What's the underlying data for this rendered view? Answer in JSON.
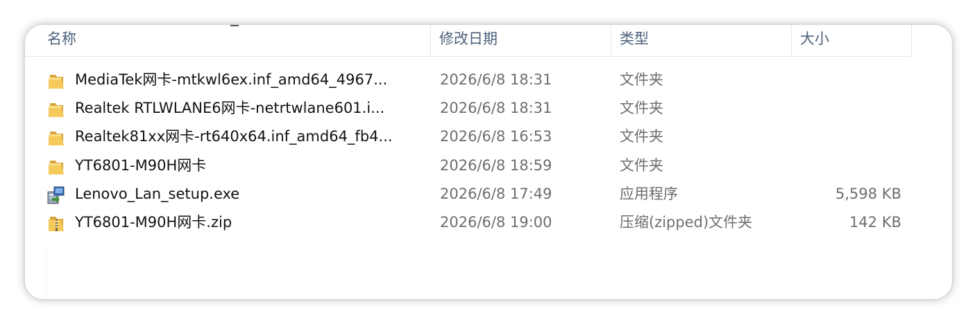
{
  "columns": {
    "name": "名称",
    "date": "修改日期",
    "type": "类型",
    "size": "大小"
  },
  "files": [
    {
      "icon": "folder-icon",
      "name": "MediaTek网卡-mtkwl6ex.inf_amd64_4967...",
      "date": "2026/6/8 18:31",
      "type": "文件夹",
      "size": ""
    },
    {
      "icon": "folder-icon",
      "name": "Realtek RTLWLANE6网卡-netrtwlane601.i...",
      "date": "2026/6/8 18:31",
      "type": "文件夹",
      "size": ""
    },
    {
      "icon": "folder-icon",
      "name": "Realtek81xx网卡-rt640x64.inf_amd64_fb4...",
      "date": "2026/6/8 16:53",
      "type": "文件夹",
      "size": ""
    },
    {
      "icon": "folder-icon",
      "name": "YT6801-M90H网卡",
      "date": "2026/6/8 18:59",
      "type": "文件夹",
      "size": ""
    },
    {
      "icon": "installer-icon",
      "name": "Lenovo_Lan_setup.exe",
      "date": "2026/6/8 17:49",
      "type": "应用程序",
      "size": "5,598 KB"
    },
    {
      "icon": "zip-folder-icon",
      "name": "YT6801-M90H网卡.zip",
      "date": "2026/6/8 19:00",
      "type": "压缩(zipped)文件夹",
      "size": "142 KB"
    }
  ],
  "colors": {
    "header_text": "#4c607a",
    "name_text": "#111111",
    "meta_text": "#6d6d6d",
    "folder_yellow": "#f2c14e"
  }
}
